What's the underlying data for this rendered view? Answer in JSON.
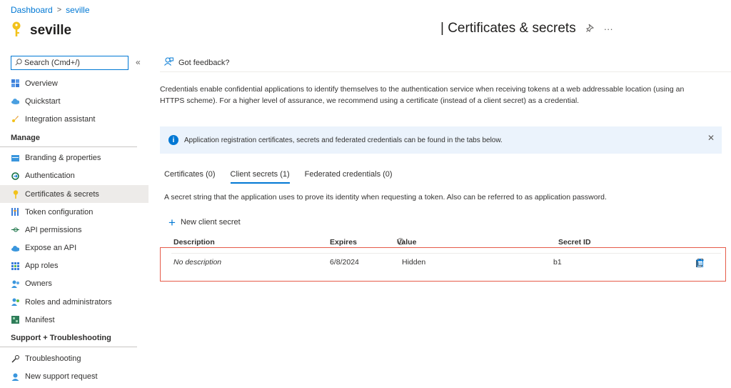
{
  "breadcrumb": {
    "home": "Dashboard",
    "separator": ">",
    "current": "seville"
  },
  "app": {
    "name": "seville",
    "icon": "key-icon"
  },
  "page": {
    "title": "| Certificates & secrets",
    "pin_icon": "pin-icon",
    "more": "···"
  },
  "search": {
    "placeholder": "Search (Cmd+/)",
    "collapse": "«"
  },
  "sidebar": {
    "items_top": [
      {
        "label": "Overview",
        "icon": "grid-icon"
      },
      {
        "label": "Quickstart",
        "icon": "cloud-icon"
      },
      {
        "label": "Integration assistant",
        "icon": "rocket-icon"
      }
    ],
    "manage_header": "Manage",
    "items_manage": [
      {
        "label": "Branding & properties",
        "icon": "branding-icon"
      },
      {
        "label": "Authentication",
        "icon": "authentication-icon"
      },
      {
        "label": "Certificates & secrets",
        "icon": "key-icon"
      },
      {
        "label": "Token configuration",
        "icon": "token-icon"
      },
      {
        "label": "API permissions",
        "icon": "permissions-icon"
      },
      {
        "label": "Expose an API",
        "icon": "cloud-api-icon"
      },
      {
        "label": "App roles",
        "icon": "roles-icon"
      },
      {
        "label": "Owners",
        "icon": "owners-icon"
      },
      {
        "label": "Roles and administrators",
        "icon": "admins-icon"
      },
      {
        "label": "Manifest",
        "icon": "manifest-icon"
      }
    ],
    "support_header": "Support + Troubleshooting",
    "items_support": [
      {
        "label": "Troubleshooting",
        "icon": "wrench-icon"
      },
      {
        "label": "New support request",
        "icon": "support-icon"
      }
    ]
  },
  "main": {
    "feedback": "Got feedback?",
    "description": "Credentials enable confidential applications to identify themselves to the authentication service when receiving tokens at a web addressable location (using an HTTPS scheme). For a higher level of assurance, we recommend using a certificate (instead of a client secret) as a credential.",
    "banner": "Application registration certificates, secrets and federated credentials can be found in the tabs below.",
    "tabs": [
      "Certificates (0)",
      "Client secrets (1)",
      "Federated credentials (0)"
    ],
    "active_tab": 1,
    "tab_description": "A secret string that the application uses to prove its identity when requesting a token. Also can be referred to as application password.",
    "new_button": "New client secret",
    "columns": [
      "Description",
      "Expires",
      "Value",
      "Secret ID"
    ],
    "rows": [
      {
        "description": "No description",
        "expires": "6/8/2024",
        "value": "Hidden",
        "secret_id": "b1"
      }
    ]
  },
  "colors": {
    "accent": "#0078d4",
    "highlight_border": "#e65b49",
    "active_nav": "#edebe9",
    "banner_bg": "#ebf3fc"
  }
}
